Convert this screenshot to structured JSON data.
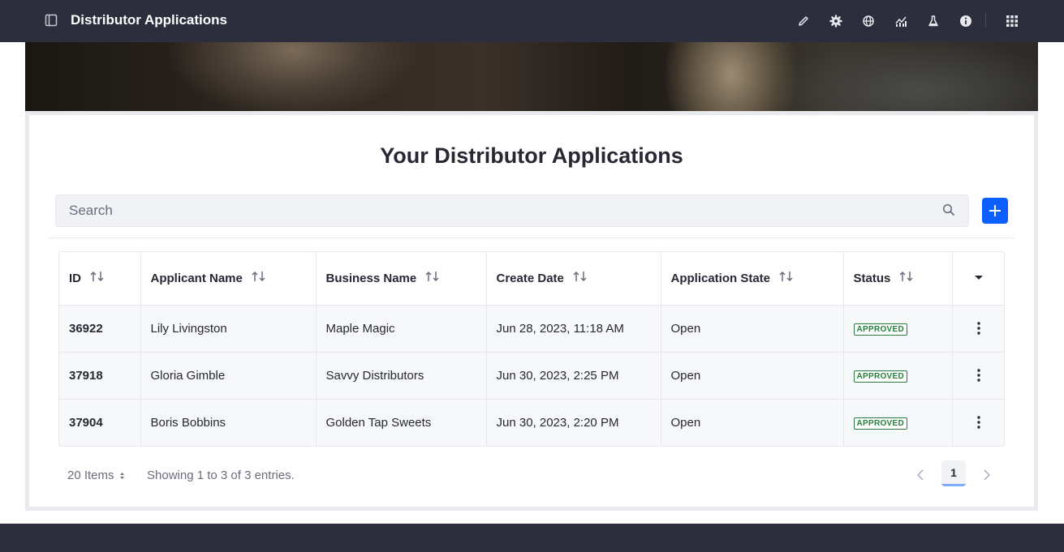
{
  "header": {
    "title": "Distributor Applications",
    "icons": [
      "sidebar-toggle-icon",
      "pencil-icon",
      "gear-icon",
      "globe-icon",
      "analytics-icon",
      "flask-icon",
      "info-icon",
      "apps-grid-icon"
    ]
  },
  "main": {
    "page_title": "Your Distributor Applications",
    "search": {
      "placeholder": "Search",
      "value": ""
    },
    "table": {
      "columns": [
        "ID",
        "Applicant Name",
        "Business Name",
        "Create Date",
        "Application State",
        "Status"
      ],
      "rows": [
        {
          "id": "36922",
          "applicant": "Lily Livingston",
          "business": "Maple Magic",
          "date": "Jun 28, 2023, 11:18 AM",
          "state": "Open",
          "status": "APPROVED"
        },
        {
          "id": "37918",
          "applicant": "Gloria Gimble",
          "business": "Savvy Distributors",
          "date": "Jun 30, 2023, 2:25 PM",
          "state": "Open",
          "status": "APPROVED"
        },
        {
          "id": "37904",
          "applicant": "Boris Bobbins",
          "business": "Golden Tap Sweets",
          "date": "Jun 30, 2023, 2:20 PM",
          "state": "Open",
          "status": "APPROVED"
        }
      ]
    },
    "pagination": {
      "items_per_page": "20 Items",
      "entries_text": "Showing 1 to 3 of 3 entries.",
      "current_page": "1"
    }
  },
  "colors": {
    "topbar": "#2c2e3d",
    "accent": "#0b5fff",
    "approved": "#287d3c"
  }
}
